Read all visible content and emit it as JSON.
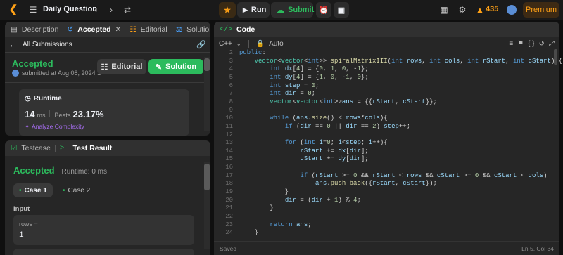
{
  "topbar": {
    "title": "Daily Question",
    "run_label": "Run",
    "submit_label": "Submit",
    "streak": "435",
    "premium_label": "Premium"
  },
  "left_panel": {
    "tabs": [
      {
        "label": "Description"
      },
      {
        "label": "Accepted"
      },
      {
        "label": "Editorial"
      },
      {
        "label": "Solutions"
      }
    ],
    "all_submissions": "All Submissions",
    "status": "Accepted",
    "submitted_text": "submitted at Aug 08, 2024 1",
    "editorial_button": "Editorial",
    "solution_button": "Solution",
    "runtime_title": "Runtime",
    "runtime_value": "14",
    "runtime_unit": "ms",
    "beats_label": "Beats",
    "beats_value": "23.17%",
    "analyze_label": "Analyze Complexity"
  },
  "bottom_panel": {
    "tabs": [
      {
        "label": "Testcase"
      },
      {
        "label": "Test Result"
      }
    ],
    "status": "Accepted",
    "runtime_text": "Runtime: 0 ms",
    "cases": [
      {
        "label": "Case 1"
      },
      {
        "label": "Case 2"
      }
    ],
    "input_label": "Input",
    "var_name": "rows =",
    "var_value": "1"
  },
  "code_panel": {
    "title": "Code",
    "language": "C++",
    "auto_label": "Auto",
    "status_text": "Saved",
    "cursor_text": "Ln 5, Col 34",
    "line_numbers": [
      "2",
      "3",
      "4",
      "5",
      "6",
      "7",
      "8",
      "9",
      "10",
      "11",
      "12",
      "13",
      "14",
      "15",
      "16",
      "17",
      "18",
      "19",
      "20",
      "21",
      "22",
      "23",
      "24"
    ]
  },
  "colors": {
    "accent": "#ffa116",
    "green": "#2cbb5d",
    "page_bg": "#0f0f0f",
    "panel_bg": "#262626"
  }
}
